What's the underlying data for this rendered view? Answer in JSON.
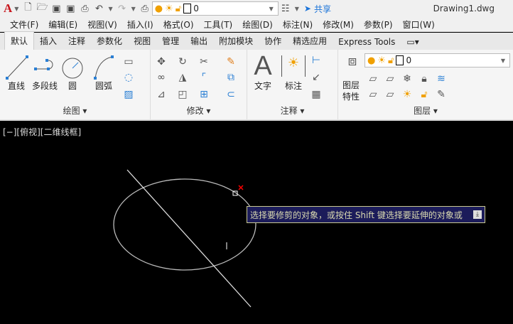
{
  "app": {
    "logo": "A",
    "title": "Drawing1.dwg",
    "share": "共享",
    "layer_value": "0"
  },
  "menu": [
    "文件(F)",
    "编辑(E)",
    "视图(V)",
    "插入(I)",
    "格式(O)",
    "工具(T)",
    "绘图(D)",
    "标注(N)",
    "修改(M)",
    "参数(P)",
    "窗口(W)"
  ],
  "tabs": [
    "默认",
    "插入",
    "注释",
    "参数化",
    "视图",
    "管理",
    "输出",
    "附加模块",
    "协作",
    "精选应用",
    "Express Tools"
  ],
  "ribbon": {
    "draw": {
      "title": "绘图",
      "line": "直线",
      "polyline": "多段线",
      "circle": "圆",
      "arc": "圆弧"
    },
    "modify": {
      "title": "修改"
    },
    "annotation": {
      "title": "注释",
      "text": "文字",
      "dimension": "标注"
    },
    "layers": {
      "title": "图层",
      "properties_l1": "图层",
      "properties_l2": "特性",
      "layer_value": "0"
    }
  },
  "viewport": {
    "label": "[−][俯视][二维线框]"
  },
  "tooltip": {
    "text": "选择要修剪的对象，或按住 Shift 键选择要延伸的对象或"
  },
  "colors": {
    "accent": "#2a7fd4",
    "tooltip_bg": "#1c1c5a",
    "logo": "#c8161d"
  }
}
